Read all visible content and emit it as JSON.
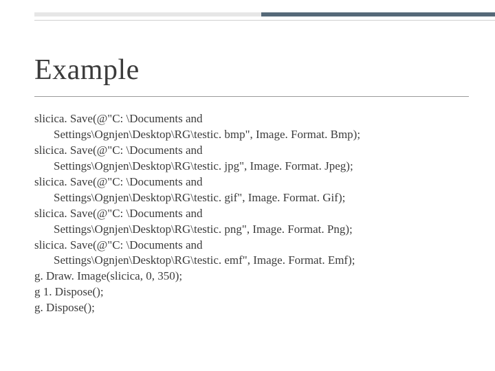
{
  "title": "Example",
  "code": {
    "l1a": "slicica. Save(@\"C: \\Documents and",
    "l1b": "Settings\\Ognjen\\Desktop\\RG\\testic. bmp\", Image. Format. Bmp);",
    "l2a": "slicica. Save(@\"C: \\Documents and",
    "l2b": "Settings\\Ognjen\\Desktop\\RG\\testic. jpg\", Image. Format. Jpeg);",
    "l3a": "slicica. Save(@\"C: \\Documents and",
    "l3b": "Settings\\Ognjen\\Desktop\\RG\\testic. gif\", Image. Format. Gif);",
    "l4a": "slicica. Save(@\"C: \\Documents and",
    "l4b": "Settings\\Ognjen\\Desktop\\RG\\testic. png\", Image. Format. Png);",
    "l5a": "slicica. Save(@\"C: \\Documents and",
    "l5b": "Settings\\Ognjen\\Desktop\\RG\\testic. emf\", Image. Format. Emf);",
    "l6": "g. Draw. Image(slicica, 0, 350);",
    "l7": "g 1. Dispose();",
    "l8": "g. Dispose();"
  }
}
